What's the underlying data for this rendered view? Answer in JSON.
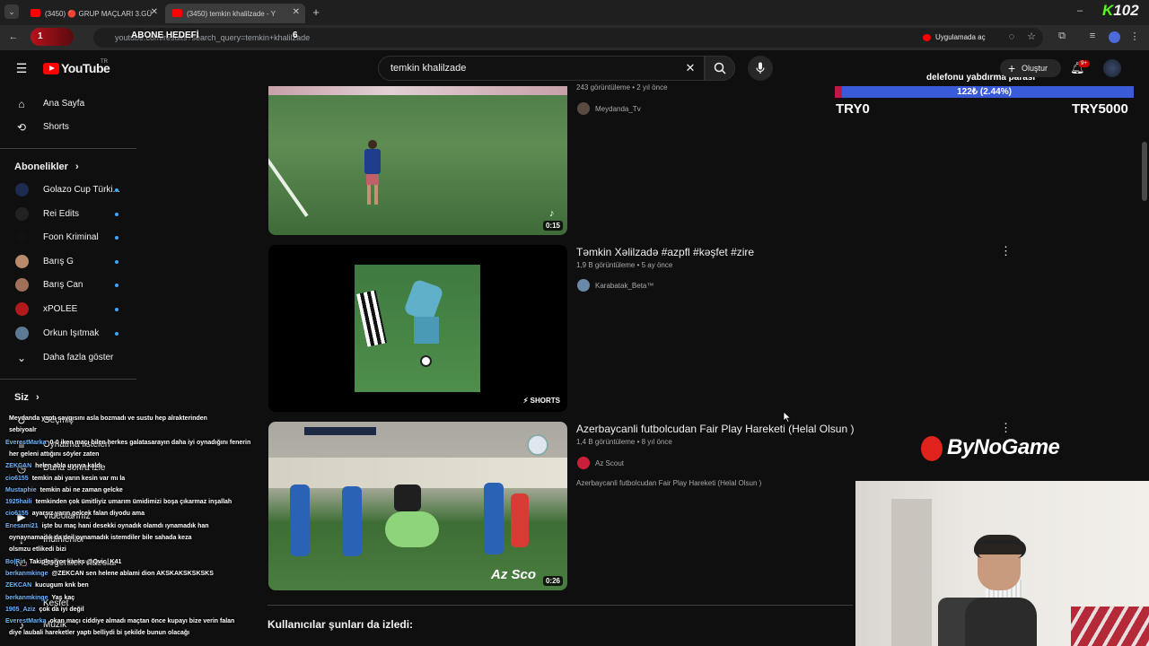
{
  "browser": {
    "tabs": [
      {
        "label": "(3450) 🔴 GRUP MAÇLARI 3.GÜ"
      },
      {
        "label": "(3450) temkin khalilzade - Y"
      }
    ],
    "url": "youtube.com/results?search_query=temkin+khalilzade",
    "open_in_app": "Uygulamada aç",
    "overlay_left_badge": "1",
    "overlay_title": "ABONE HEDEFİ",
    "overlay_count": "6",
    "stream_logo": "102"
  },
  "header": {
    "logo_text": "YouTube",
    "logo_tr": "TR",
    "search_value": "temkin khalilzade",
    "create_label": "Oluştur",
    "notif_count": "9+"
  },
  "sidebar": {
    "main": [
      {
        "label": "Ana Sayfa",
        "icon": "home-icon"
      },
      {
        "label": "Shorts",
        "icon": "shorts-icon"
      }
    ],
    "subs_heading": "Abonelikler",
    "subs": [
      {
        "label": "Golazo Cup Türki...",
        "color": "#1e2a50"
      },
      {
        "label": "Rei Edits",
        "color": "#222"
      },
      {
        "label": "Foon Kriminal",
        "color": "#111"
      },
      {
        "label": "Barış G",
        "color": "#b98b6a"
      },
      {
        "label": "Barış Can",
        "color": "#a0705a"
      },
      {
        "label": "xPOLEE",
        "color": "#b01a1a"
      },
      {
        "label": "Orkun Işıtmak",
        "color": "#5a7a95"
      }
    ],
    "more_label": "Daha fazla göster",
    "you_heading": "Siz",
    "you_items": [
      {
        "label": "Geçmiş"
      },
      {
        "label": "Oynatma listeleri"
      },
      {
        "label": "Daha sonra izle"
      },
      {
        "label": "Videolarınız"
      },
      {
        "label": "İndirilenler"
      },
      {
        "label": "Beğenilen videolar"
      },
      {
        "label": "Keşfet"
      },
      {
        "label": "Müzik"
      }
    ]
  },
  "results": [
    {
      "meta": "243 görüntüleme • 2 yıl önce",
      "channel": "Meydanda_Tv",
      "duration": "0:15"
    },
    {
      "title": "Təmkin Xəlilzadə #azpfl #kəşfet #zire",
      "meta": "1,9 B görüntüleme • 5 ay önce",
      "channel": "Karabatak_Beta™",
      "badge": "SHORTS"
    },
    {
      "title": "Azerbaycanli futbolcudan Fair Play Hareketi (Helal Olsun )",
      "meta": "1,4 B görüntüleme • 8 yıl önce",
      "channel": "Az Scout",
      "desc": "Azerbaycanli futbolcudan Fair Play Hareketi (Helal Olsun )",
      "duration": "0:26",
      "watermark": "Az Sco"
    }
  ],
  "section_heading": "Kullanıcılar şunları da izledi:",
  "donation": {
    "title": "delefonu yabdırma parası",
    "progress_text": "122₺ (2.44%)",
    "progress_fraction": 0.0244,
    "min": "TRY0",
    "max": "TRY5000"
  },
  "sponsor": "ByNoGame",
  "chat": [
    {
      "user": "",
      "text": "Meydanda yaptı saygısını asla bozmadı ve sustu hep alrakterinden"
    },
    {
      "user": "",
      "text": "sebiyoalr"
    },
    {
      "user": "EverestMarka",
      "text": "0-0 iken maçı bilen herkes galatasarayın daha iyi oynadığını fenerin"
    },
    {
      "user": "",
      "text": "her geleni attığını söyler zaten"
    },
    {
      "user": "ZEKCAN",
      "text": "helen abla uyuya kaldı"
    },
    {
      "user": "cio6155",
      "text": "temkin abi yarın kesin var mı la"
    },
    {
      "user": "Mustaphie",
      "text": "temkin abi ne zaman gelcke"
    },
    {
      "user": "1925haili",
      "text": "temkinden çok ümitliyiz umarım ümidimizi boşa çıkarmaz inşallah"
    },
    {
      "user": "cio6155",
      "text": "ayarsız yarın gelcek falan diyodu ama"
    },
    {
      "user": "Enesami21",
      "text": "işte bu maç hani desekki oynadık olamdı ıynamadık han"
    },
    {
      "user": "",
      "text": "oynaynamadık da deil oynamadık istemdiler bile sahada keza"
    },
    {
      "user": "",
      "text": "olsmzu etlikedi bizi"
    },
    {
      "user": "Bo|Rin",
      "text": "Takipleşiyor kanks @Qvic_K41"
    },
    {
      "user": "berkanmkinge",
      "text": "@ZEKCAN sen helene ablami dion AKSKAKSKSKSKS"
    },
    {
      "user": "ZEKCAN",
      "text": "kucugum knk ben"
    },
    {
      "user": "berkanmkinge",
      "text": "Yaş kaç"
    },
    {
      "user": "1905_Aziz",
      "text": "çok da iyi değil"
    },
    {
      "user": "EverestMarka",
      "text": "okan maçı ciddiye almadı maçtan önce kupayı bize verin falan"
    },
    {
      "user": "",
      "text": "diye laubali hareketler yaptı belliydi bi şekilde bunun olacağı"
    }
  ]
}
